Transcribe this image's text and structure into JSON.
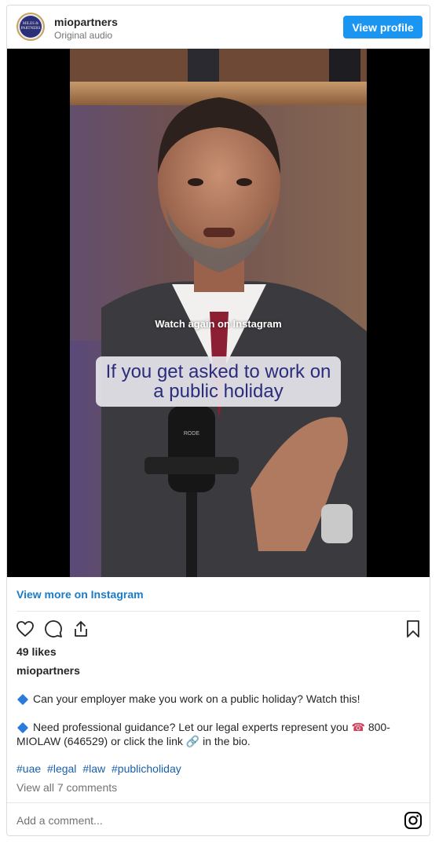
{
  "header": {
    "avatar_text": "MILES & PARTNERS",
    "username": "miopartners",
    "audio": "Original audio",
    "view_profile_label": "View profile"
  },
  "media": {
    "overlay_text": "Watch again on Instagram",
    "caption_box": "If you get asked to work on a public holiday",
    "mic_brand": "RODE"
  },
  "footer": {
    "view_more": "View more on Instagram",
    "likes": "49 likes",
    "author": "miopartners",
    "caption_line1": "Can your employer make you work on a public holiday? Watch this!",
    "caption_line2_a": "Need professional guidance? Let our legal experts represent you",
    "caption_line2_b": "800-MIOLAW (646529) or click the link",
    "caption_line2_c": "in the bio.",
    "hashtags": [
      "#uae",
      "#legal",
      "#law",
      "#publicholiday"
    ],
    "view_comments": "View all 7 comments",
    "add_comment_placeholder": "Add a comment..."
  },
  "icons": {
    "like": "heart-icon",
    "comment": "comment-icon",
    "share": "share-icon",
    "save": "bookmark-icon",
    "instagram": "instagram-icon",
    "caption_bullet": "blue-diamond-icon",
    "phone": "phone-icon",
    "link": "link-icon"
  },
  "colors": {
    "accent": "#1a95f2",
    "link": "#1a7bc8",
    "caption_box_text": "#2b2d7c"
  }
}
